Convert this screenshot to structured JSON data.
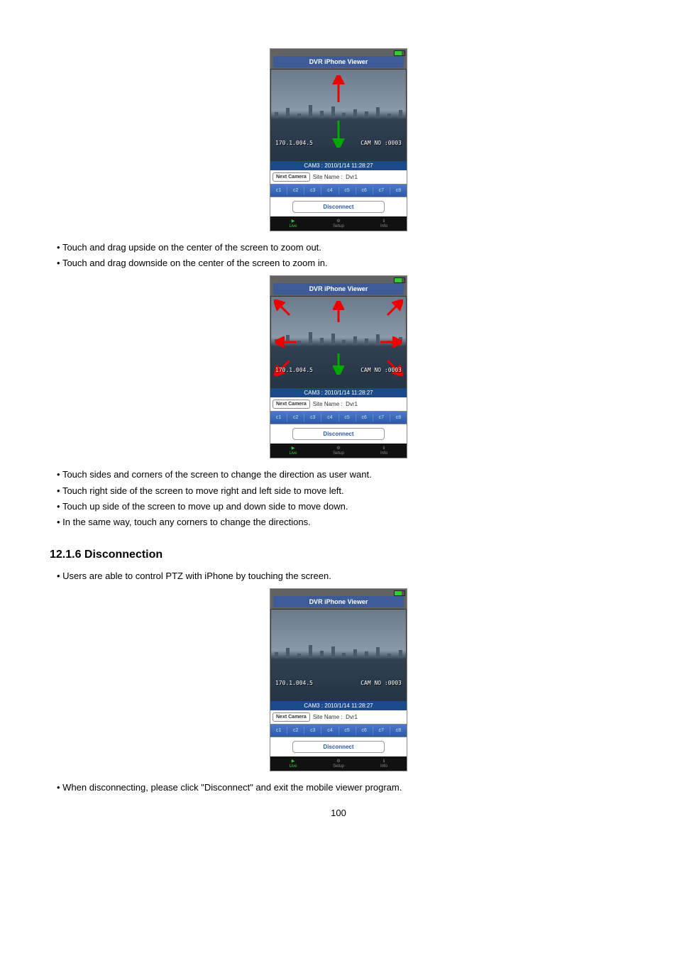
{
  "bullets_a": [
    "Touch and drag upside on the center of the screen to zoom out.",
    "Touch and drag downside on the center of the screen to zoom in."
  ],
  "bullets_b": [
    "Touch sides and corners of the screen to change the direction as user want.",
    "Touch right side of the screen to move right and left side to move left.",
    "Touch up side of the screen to move up and down side to move down.",
    "In the same way, touch any corners to change the directions."
  ],
  "heading": "12.1.6  Disconnection",
  "bullets_c": [
    "Users are able to control PTZ with iPhone by touching the screen."
  ],
  "bullets_d": [
    "When disconnecting, please click \"Disconnect\" and exit the mobile viewer program."
  ],
  "page_num": "100",
  "viewer": {
    "title": "DVR iPhone Viewer",
    "overlay_left": "170.1.004.5",
    "overlay_right": "CAM NO :0003",
    "bottom_label": "CAM3 : 2010/1/14 11:28:27",
    "next_camera": "Next Camera",
    "site_label": "Site Name :",
    "site_value": "Dvr1",
    "cams": [
      "c1",
      "c2",
      "c3",
      "c4",
      "c5",
      "c6",
      "c7",
      "c8"
    ],
    "disconnect": "Disconnect",
    "tabs": {
      "live": "Live",
      "setup": "Setup",
      "info": "Info"
    }
  }
}
